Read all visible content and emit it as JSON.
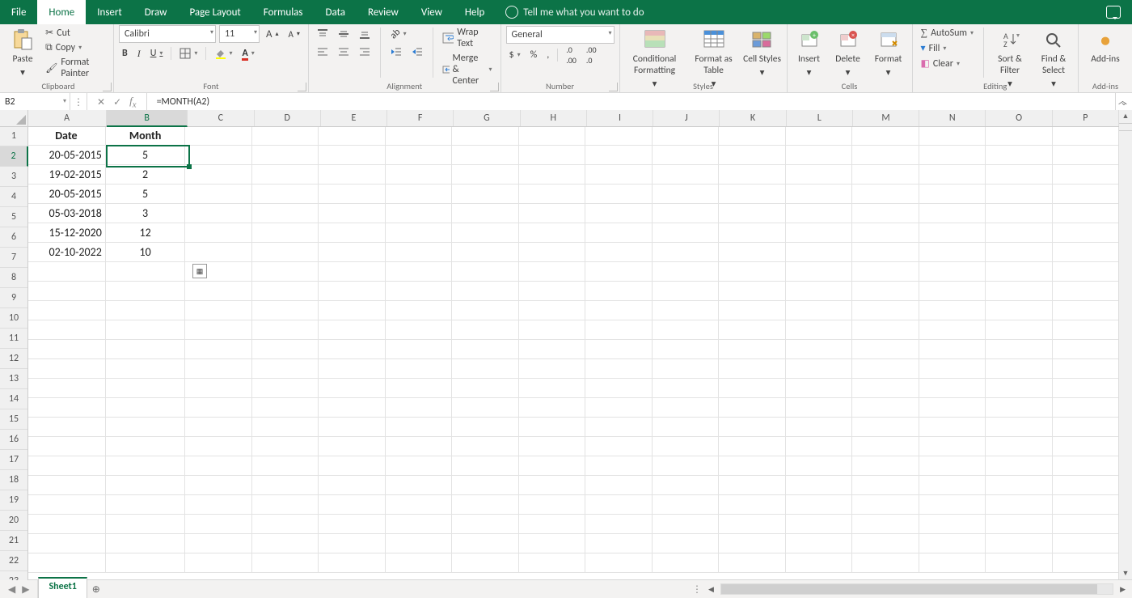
{
  "colors": {
    "accent": "#0c7347",
    "ribbon_bg": "#f3f2f1"
  },
  "tabs": {
    "file": "File",
    "home": "Home",
    "insert": "Insert",
    "draw": "Draw",
    "page": "Page Layout",
    "formulas": "Formulas",
    "data": "Data",
    "review": "Review",
    "view": "View",
    "help": "Help",
    "tellme": "Tell me what you want to do",
    "active": "home"
  },
  "ribbon": {
    "clipboard": {
      "paste": "Paste",
      "cut": "Cut",
      "copy": "Copy",
      "format_painter": "Format Painter",
      "title": "Clipboard"
    },
    "font": {
      "name": "Calibri",
      "size": "11",
      "bold": "B",
      "italic": "I",
      "underline": "U",
      "title": "Font"
    },
    "alignment": {
      "wrap": "Wrap Text",
      "merge": "Merge & Center",
      "title": "Alignment"
    },
    "number": {
      "format": "General",
      "title": "Number"
    },
    "styles": {
      "cond": "Conditional Formatting",
      "table": "Format as Table",
      "cell": "Cell Styles",
      "title": "Styles"
    },
    "cells": {
      "insert": "Insert",
      "delete": "Delete",
      "format": "Format",
      "title": "Cells"
    },
    "editing": {
      "autosum": "AutoSum",
      "fill": "Fill",
      "clear": "Clear",
      "sort": "Sort & Filter",
      "find": "Find & Select",
      "title": "Editing"
    },
    "addins": {
      "label": "Add-ins",
      "title": "Add-ins"
    }
  },
  "formula_bar": {
    "cell_ref": "B2",
    "formula": "=MONTH(A2)"
  },
  "grid": {
    "columns": [
      "A",
      "B",
      "C",
      "D",
      "E",
      "F",
      "G",
      "H",
      "I",
      "J",
      "K",
      "L",
      "M",
      "N",
      "O",
      "P"
    ],
    "col_widths": {
      "A": 98,
      "B": 100,
      "default": 82
    },
    "row_count": 22,
    "selected_cell": {
      "row": 2,
      "col": "B"
    },
    "headers": {
      "A1": "Date",
      "B1": "Month"
    },
    "data": [
      {
        "row": 2,
        "A": "20-05-2015",
        "B": "5"
      },
      {
        "row": 3,
        "A": "19-02-2015",
        "B": "2"
      },
      {
        "row": 4,
        "A": "20-05-2015",
        "B": "5"
      },
      {
        "row": 5,
        "A": "05-03-2018",
        "B": "3"
      },
      {
        "row": 6,
        "A": "15-12-2020",
        "B": "12"
      },
      {
        "row": 7,
        "A": "02-10-2022",
        "B": "10"
      }
    ],
    "autofill_flyout_at": {
      "row": 8,
      "col": "C"
    }
  },
  "sheets": {
    "active": "Sheet1"
  }
}
